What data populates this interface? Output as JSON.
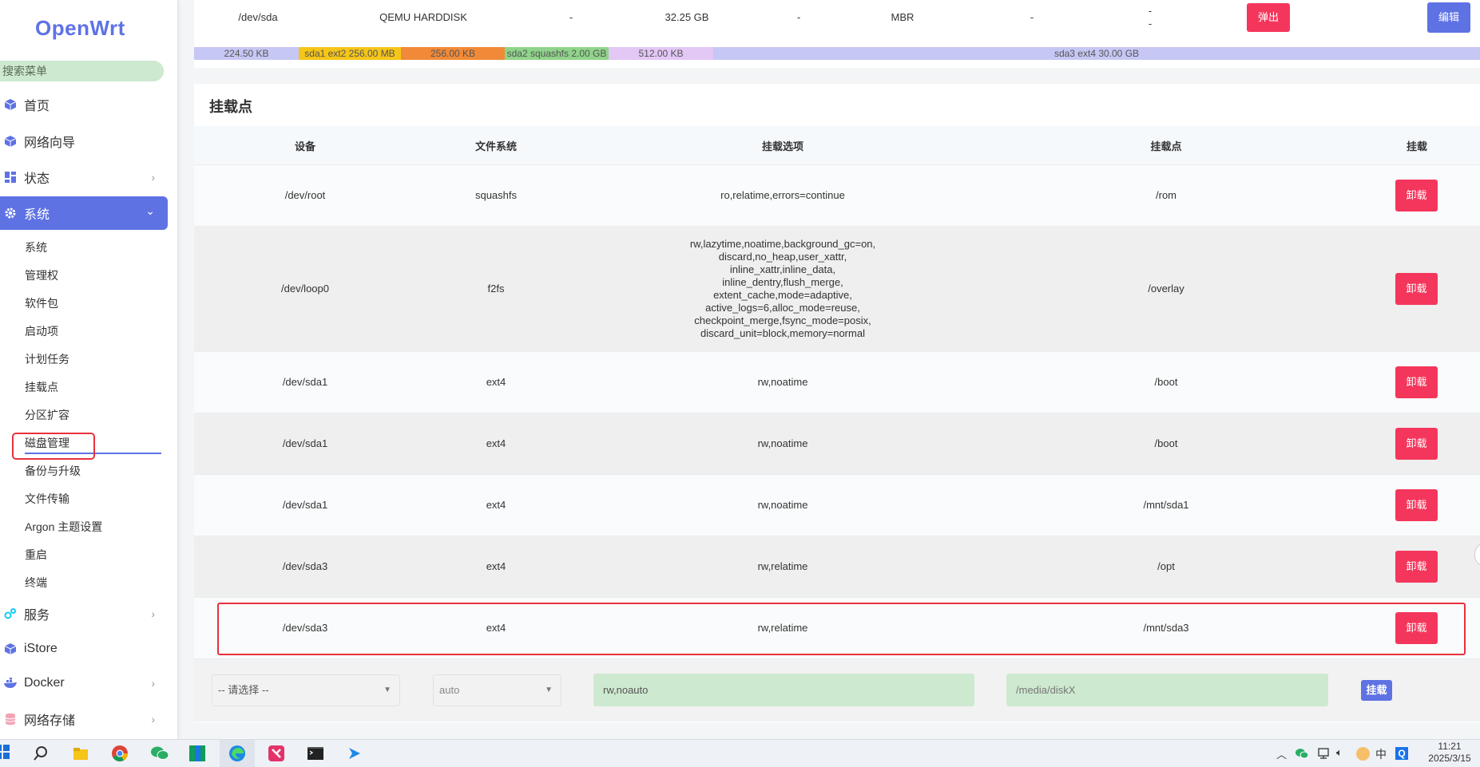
{
  "brand": {
    "logo": "OpenWrt",
    "accent": "#5e72e4",
    "danger": "#f5365c"
  },
  "sidebar": {
    "search_placeholder": "搜索菜单",
    "items": [
      {
        "label": "首页",
        "icon": "cube-icon"
      },
      {
        "label": "网络向导",
        "icon": "cube-icon"
      },
      {
        "label": "状态",
        "icon": "dashboard-icon"
      },
      {
        "label": "系统",
        "icon": "gear-icon"
      },
      {
        "label": "服务",
        "icon": "gears-icon"
      },
      {
        "label": "iStore",
        "icon": "cube-icon"
      },
      {
        "label": "Docker",
        "icon": "docker-icon"
      },
      {
        "label": "网络存储",
        "icon": "database-icon"
      }
    ],
    "system_sub": [
      "系统",
      "管理权",
      "软件包",
      "启动项",
      "计划任务",
      "挂载点",
      "分区扩容",
      "磁盘管理",
      "备份与升级",
      "文件传输",
      "Argon 主题设置",
      "重启",
      "终端"
    ]
  },
  "disk": {
    "device": "/dev/sda",
    "model": "QEMU HARDDISK",
    "dash1": "-",
    "size": "32.25 GB",
    "dash2": "-",
    "table": "MBR",
    "dash3": "-",
    "dash4": "-",
    "dash5": "-",
    "eject_label": "弹出",
    "edit_label": "编辑",
    "partitions": [
      {
        "label": "224.50 KB",
        "color": "#c7c7f5"
      },
      {
        "label": "sda1 ext2 256.00 MB",
        "color": "#f5c518"
      },
      {
        "label": "256.00 KB",
        "color": "#f08a38"
      },
      {
        "label": "sda2 squashfs 2.00 GB",
        "color": "#8fd48a"
      },
      {
        "label": "512.00 KB",
        "color": "#e3c7f5"
      },
      {
        "label": "sda3 ext4 30.00 GB",
        "color": "#c7c7f5"
      }
    ]
  },
  "mounts": {
    "title": "挂载点",
    "headers": [
      "设备",
      "文件系统",
      "挂载选项",
      "挂载点",
      "挂载"
    ],
    "rows": [
      {
        "device": "/dev/root",
        "fs": "squashfs",
        "options": [
          "ro,relatime,errors=continue"
        ],
        "mount": "/rom",
        "action": "卸载"
      },
      {
        "device": "/dev/loop0",
        "fs": "f2fs",
        "options": [
          "rw,lazytime,noatime,background_gc=on,",
          "discard,no_heap,user_xattr,",
          "inline_xattr,inline_data,",
          "inline_dentry,flush_merge,",
          "extent_cache,mode=adaptive,",
          "active_logs=6,alloc_mode=reuse,",
          "checkpoint_merge,fsync_mode=posix,",
          "discard_unit=block,memory=normal"
        ],
        "mount": "/overlay",
        "action": "卸载"
      },
      {
        "device": "/dev/sda1",
        "fs": "ext4",
        "options": [
          "rw,noatime"
        ],
        "mount": "/boot",
        "action": "卸载"
      },
      {
        "device": "/dev/sda1",
        "fs": "ext4",
        "options": [
          "rw,noatime"
        ],
        "mount": "/boot",
        "action": "卸载"
      },
      {
        "device": "/dev/sda1",
        "fs": "ext4",
        "options": [
          "rw,noatime"
        ],
        "mount": "/mnt/sda1",
        "action": "卸载"
      },
      {
        "device": "/dev/sda3",
        "fs": "ext4",
        "options": [
          "rw,relatime"
        ],
        "mount": "/opt",
        "action": "卸载"
      },
      {
        "device": "/dev/sda3",
        "fs": "ext4",
        "options": [
          "rw,relatime"
        ],
        "mount": "/mnt/sda3",
        "action": "卸载"
      }
    ],
    "form": {
      "device_select": "-- 请选择 --",
      "fs_select": "auto",
      "options_value": "rw,noauto",
      "mount_placeholder": "/media/diskX",
      "mount_button": "挂载"
    }
  },
  "taskbar": {
    "time": "11:21",
    "date": "2025/3/15",
    "ime": "中"
  }
}
